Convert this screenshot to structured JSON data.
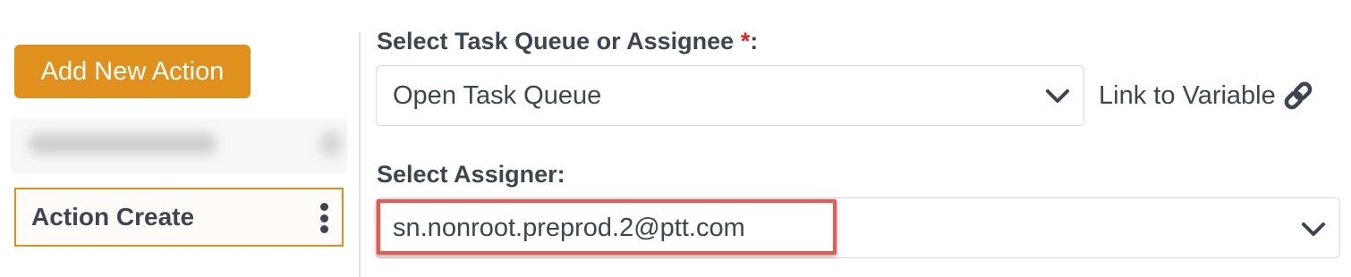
{
  "sidebar": {
    "add_button_label": "Add New Action",
    "items": [
      {
        "label": "",
        "blurred": true
      },
      {
        "label": "Action Create",
        "selected": true
      }
    ]
  },
  "form": {
    "task_queue": {
      "label": "Select Task Queue or Assignee",
      "required_marker": "*",
      "label_suffix": ":",
      "value": "Open Task Queue",
      "link_label": "Link to Variable"
    },
    "assigner": {
      "label": "Select Assigner:",
      "value": "sn.nonroot.preprod.2@ptt.com"
    }
  },
  "icons": {
    "dropdown": "chevron-down-icon",
    "link": "link-icon",
    "menu": "kebab-menu-icon"
  },
  "colors": {
    "accent": "#e0901c",
    "text": "#3d4650",
    "required": "#e0231b",
    "highlight": "#f0564c"
  }
}
